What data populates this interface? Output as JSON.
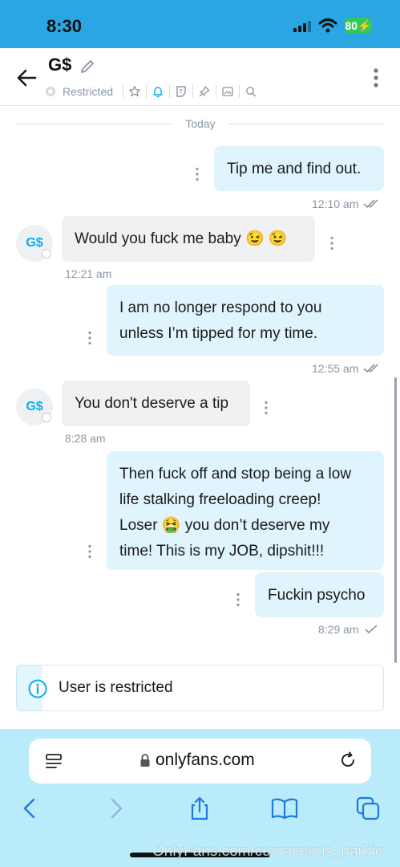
{
  "status_bar": {
    "time": "8:30",
    "battery": "80"
  },
  "header": {
    "chat_name": "G$",
    "status_label": "Restricted"
  },
  "day_divider": "Today",
  "messages": [
    {
      "direction": "out",
      "lines": [
        "Tip me and find out."
      ],
      "time": "12:10 am",
      "check": "double"
    },
    {
      "direction": "in",
      "avatar": "G$",
      "lines": [
        "Would you fuck me baby 😉 😉"
      ],
      "time": "12:21 am"
    },
    {
      "direction": "out",
      "lines": [
        "I am no longer respond to you",
        "unless I’m tipped for my time."
      ],
      "time": "12:55 am",
      "check": "double"
    },
    {
      "direction": "in",
      "avatar": "G$",
      "lines": [
        "You don't deserve a tip"
      ],
      "time": "8:28 am"
    },
    {
      "direction": "out",
      "lines": [
        "Then fuck off and stop being a low",
        "life stalking freeloading creep!",
        "Loser 🤮 you don’t deserve my",
        "time! This is my JOB, dipshit!!!"
      ]
    },
    {
      "direction": "out",
      "lines": [
        "Fuckin psycho"
      ],
      "time": "8:29 am",
      "check": "single"
    }
  ],
  "notice": {
    "text": "User is restricted"
  },
  "browser": {
    "url": "onlyfans.com"
  },
  "watermark": "OnlyFans.com/curvaceous_barbie",
  "colors": {
    "brand": "#00aff0",
    "status_bar": "#2aa7e2",
    "outgoing_bubble": "#e0f4fd",
    "incoming_bubble": "#f0f1f3",
    "browser_bar": "#b9ebfa"
  },
  "icons": [
    "back-arrow-icon",
    "pencil-icon",
    "star-icon",
    "bell-icon",
    "sticker-icon",
    "pin-icon",
    "image-icon",
    "search-icon",
    "more-vertical-icon",
    "info-icon",
    "lock-icon",
    "reload-icon",
    "tabs-menu-icon",
    "back-icon",
    "forward-icon",
    "share-icon",
    "bookmarks-icon",
    "tabs-icon"
  ]
}
